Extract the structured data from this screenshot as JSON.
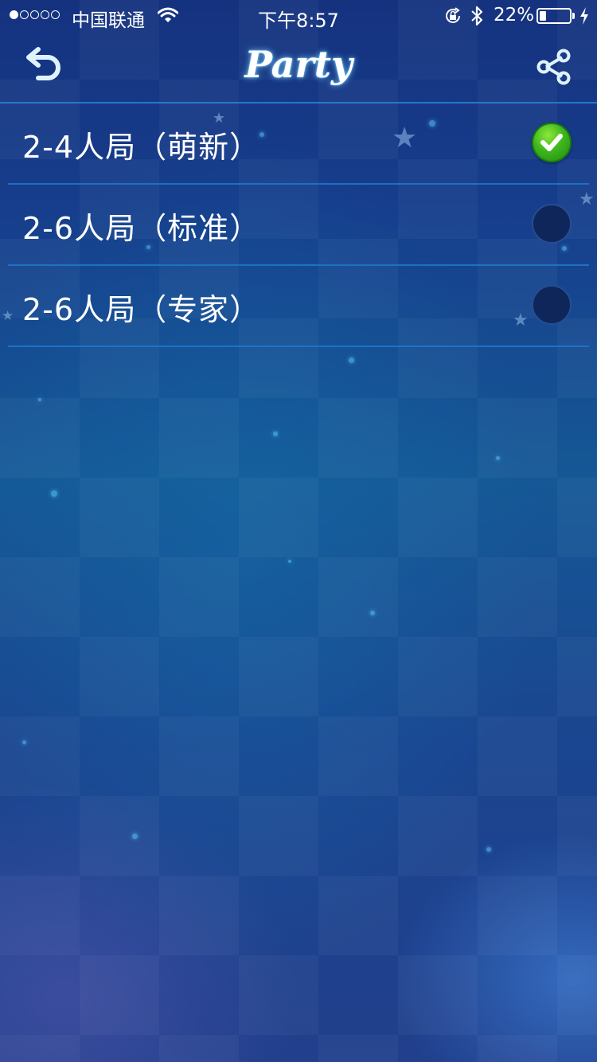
{
  "status_bar": {
    "carrier": "中国联通",
    "time": "下午8:57",
    "battery_percent": "22%",
    "battery_level": 0.22,
    "signal_bars_filled": 1,
    "signal_bars_total": 5
  },
  "nav": {
    "title": "Party",
    "back_icon": "undo-arrow-icon",
    "share_icon": "share-icon"
  },
  "options": [
    {
      "label": "2-4人局（萌新）",
      "selected": true
    },
    {
      "label": "2-6人局（标准）",
      "selected": false
    },
    {
      "label": "2-6人局（专家）",
      "selected": false
    }
  ],
  "colors": {
    "accent": "#2882d7",
    "check_green": "#3fb81e",
    "title_glow": "#78d2ff"
  }
}
